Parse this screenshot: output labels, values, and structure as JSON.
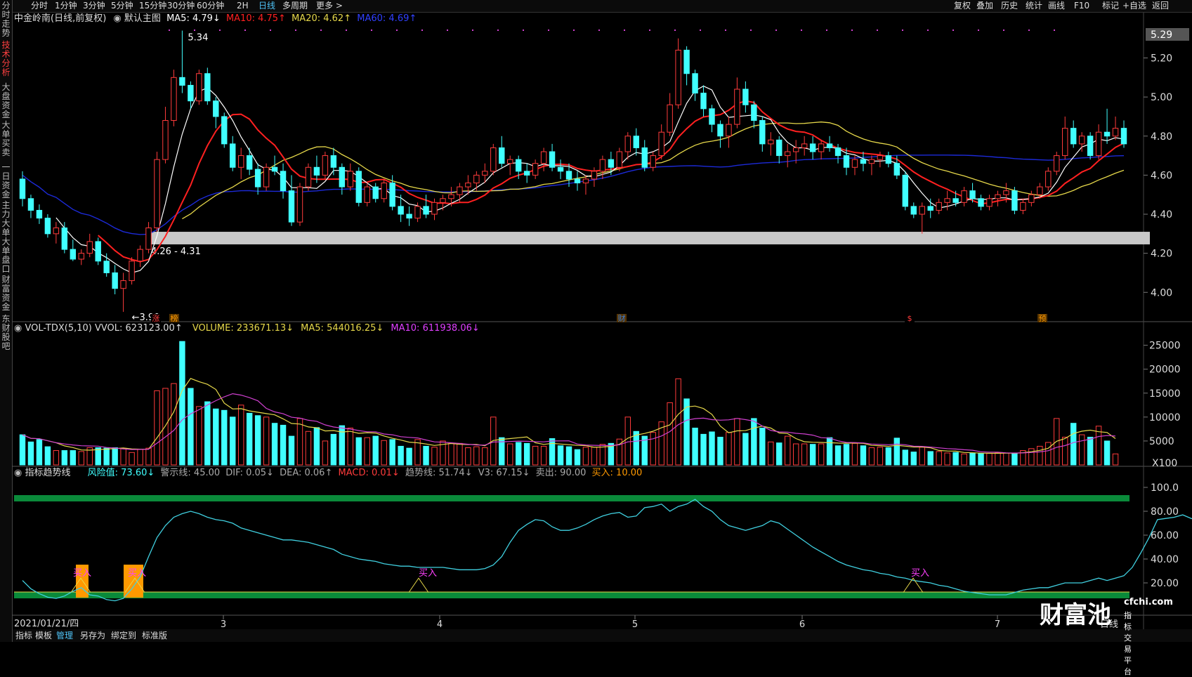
{
  "left_tabs": [
    {
      "label": "分时走势",
      "active": false
    },
    {
      "label": "技术分析",
      "active": true
    },
    {
      "label": "大盘资金",
      "active": false
    },
    {
      "label": "大单买卖",
      "active": false
    },
    {
      "label": "一日资金",
      "active": false
    },
    {
      "label": "主力大单",
      "active": false
    },
    {
      "label": "大单盘口",
      "active": false
    },
    {
      "label": "财富资金",
      "active": false
    },
    {
      "label": "东财股吧",
      "active": false
    }
  ],
  "top_periods": [
    "分时",
    "1分钟",
    "3分钟",
    "5分钟",
    "15分钟",
    "30分钟",
    "60分钟",
    "2H",
    "日线",
    "多周期",
    "更多 >"
  ],
  "active_period": "日线",
  "top_right": [
    "复权",
    "叠加",
    "历史",
    "统计",
    "画线",
    "F10",
    "标记",
    "+自选",
    "返回"
  ],
  "kline_header": {
    "stock": "中金岭南(日线,前复权)",
    "template": "默认主图",
    "ma5": "MA5: 4.79↓",
    "ma10": "MA10: 4.75↑",
    "ma20": "MA20: 4.62↑",
    "ma60": "MA60: 4.69↑"
  },
  "price_axis": {
    "top": "5.29",
    "ticks": [
      "5.20",
      "5.00",
      "4.80",
      "4.60",
      "4.40",
      "4.20",
      "4.00"
    ]
  },
  "annotations": {
    "high": "5.34",
    "low": "3.90",
    "band": "4.26 - 4.31"
  },
  "event_marks": [
    "涨",
    "榜",
    "财",
    "$",
    "预"
  ],
  "vol_header": {
    "name": "VOL-TDX(5,10)",
    "vvol": "VVOL: 623123.00↑",
    "volume": "VOLUME: 233671.13↓",
    "ma5": "MA5: 544016.25↓",
    "ma10": "MA10: 611938.06↓"
  },
  "vol_axis": {
    "ticks": [
      "25000",
      "20000",
      "15000",
      "10000",
      "5000"
    ],
    "unit": "X100"
  },
  "ind_header": {
    "name": "指标趋势线",
    "risk": "风险值: 73.60↓",
    "warn": "警示线: 45.00",
    "dif": "DIF: 0.05↓",
    "dea": "DEA: 0.06↑",
    "macd": "MACD: 0.01↓",
    "trend": "趋势线: 51.74↓",
    "v3": "V3: 67.15↓",
    "sell": "卖出: 90.00",
    "buy": "买入: 10.00"
  },
  "ind_axis": {
    "ticks": [
      "100.0",
      "80.00",
      "60.00",
      "40.00",
      "20.00"
    ]
  },
  "buy_label": "买入",
  "date_axis": {
    "first": "2021/01/21/四",
    "months": [
      "3",
      "4",
      "5",
      "6",
      "7"
    ],
    "right": "日线"
  },
  "bottom_tabs": [
    "指标",
    "模板",
    "管理",
    "另存为",
    "绑定到",
    "标准版"
  ],
  "active_bottom": "管理",
  "watermark": {
    "brand": "财富池",
    "url": "cfchi.com",
    "slogan": "指标交易平台"
  },
  "colors": {
    "up": "#ff3b3b",
    "down": "#40ffff",
    "ma5": "#ffffff",
    "ma10": "#ff2020",
    "ma20": "#e6d84a",
    "ma60": "#1c2ad8",
    "accent": "#4fc3f7",
    "green_band": "#0a8a3a",
    "buy_bar": "#ff9900"
  },
  "chart_data": {
    "type": "candlestick",
    "ylim": [
      3.85,
      5.36
    ],
    "candles": [
      [
        4.58,
        4.62,
        4.44,
        4.48
      ],
      [
        4.48,
        4.5,
        4.38,
        4.42
      ],
      [
        4.42,
        4.45,
        4.35,
        4.38
      ],
      [
        4.38,
        4.4,
        4.28,
        4.3
      ],
      [
        4.3,
        4.36,
        4.25,
        4.33
      ],
      [
        4.33,
        4.36,
        4.2,
        4.22
      ],
      [
        4.22,
        4.27,
        4.16,
        4.17
      ],
      [
        4.17,
        4.22,
        4.14,
        4.2
      ],
      [
        4.2,
        4.3,
        4.18,
        4.26
      ],
      [
        4.26,
        4.28,
        4.14,
        4.16
      ],
      [
        4.16,
        4.2,
        4.08,
        4.1
      ],
      [
        4.1,
        4.14,
        3.99,
        4.02
      ],
      [
        4.02,
        4.1,
        3.9,
        4.06
      ],
      [
        4.06,
        4.18,
        4.04,
        4.16
      ],
      [
        4.16,
        4.24,
        4.13,
        4.22
      ],
      [
        4.22,
        4.36,
        4.2,
        4.33
      ],
      [
        4.33,
        4.72,
        4.31,
        4.68
      ],
      [
        4.68,
        4.95,
        4.66,
        4.88
      ],
      [
        4.88,
        5.14,
        4.85,
        5.1
      ],
      [
        5.1,
        5.34,
        5.02,
        5.06
      ],
      [
        5.06,
        5.08,
        4.94,
        4.98
      ],
      [
        4.98,
        5.14,
        4.96,
        5.12
      ],
      [
        5.12,
        5.15,
        4.96,
        4.98
      ],
      [
        4.98,
        5.0,
        4.84,
        4.9
      ],
      [
        4.9,
        4.92,
        4.74,
        4.76
      ],
      [
        4.76,
        4.8,
        4.62,
        4.64
      ],
      [
        4.64,
        4.74,
        4.58,
        4.7
      ],
      [
        4.7,
        4.74,
        4.6,
        4.63
      ],
      [
        4.63,
        4.66,
        4.5,
        4.54
      ],
      [
        4.54,
        4.66,
        4.52,
        4.64
      ],
      [
        4.64,
        4.7,
        4.6,
        4.62
      ],
      [
        4.62,
        4.66,
        4.48,
        4.52
      ],
      [
        4.52,
        4.6,
        4.34,
        4.36
      ],
      [
        4.36,
        4.56,
        4.34,
        4.54
      ],
      [
        4.54,
        4.66,
        4.52,
        4.64
      ],
      [
        4.64,
        4.7,
        4.56,
        4.6
      ],
      [
        4.6,
        4.72,
        4.58,
        4.7
      ],
      [
        4.7,
        4.74,
        4.6,
        4.64
      ],
      [
        4.64,
        4.66,
        4.5,
        4.54
      ],
      [
        4.54,
        4.66,
        4.52,
        4.62
      ],
      [
        4.62,
        4.64,
        4.44,
        4.46
      ],
      [
        4.46,
        4.56,
        4.44,
        4.54
      ],
      [
        4.54,
        4.56,
        4.46,
        4.48
      ],
      [
        4.48,
        4.58,
        4.46,
        4.56
      ],
      [
        4.56,
        4.6,
        4.42,
        4.44
      ],
      [
        4.44,
        4.5,
        4.36,
        4.4
      ],
      [
        4.4,
        4.44,
        4.34,
        4.38
      ],
      [
        4.38,
        4.46,
        4.36,
        4.44
      ],
      [
        4.44,
        4.5,
        4.38,
        4.4
      ],
      [
        4.4,
        4.48,
        4.37,
        4.46
      ],
      [
        4.46,
        4.5,
        4.42,
        4.48
      ],
      [
        4.48,
        4.54,
        4.44,
        4.5
      ],
      [
        4.5,
        4.56,
        4.46,
        4.54
      ],
      [
        4.54,
        4.6,
        4.5,
        4.56
      ],
      [
        4.56,
        4.62,
        4.52,
        4.6
      ],
      [
        4.6,
        4.66,
        4.56,
        4.62
      ],
      [
        4.62,
        4.76,
        4.6,
        4.74
      ],
      [
        4.74,
        4.8,
        4.64,
        4.66
      ],
      [
        4.66,
        4.7,
        4.6,
        4.68
      ],
      [
        4.68,
        4.7,
        4.58,
        4.62
      ],
      [
        4.62,
        4.66,
        4.56,
        4.6
      ],
      [
        4.6,
        4.68,
        4.58,
        4.66
      ],
      [
        4.66,
        4.74,
        4.62,
        4.72
      ],
      [
        4.72,
        4.76,
        4.62,
        4.64
      ],
      [
        4.64,
        4.68,
        4.58,
        4.62
      ],
      [
        4.62,
        4.66,
        4.54,
        4.58
      ],
      [
        4.58,
        4.62,
        4.52,
        4.56
      ],
      [
        4.56,
        4.6,
        4.5,
        4.58
      ],
      [
        4.58,
        4.64,
        4.54,
        4.62
      ],
      [
        4.62,
        4.7,
        4.58,
        4.68
      ],
      [
        4.68,
        4.72,
        4.6,
        4.64
      ],
      [
        4.64,
        4.74,
        4.62,
        4.72
      ],
      [
        4.72,
        4.82,
        4.68,
        4.8
      ],
      [
        4.8,
        4.84,
        4.7,
        4.74
      ],
      [
        4.74,
        4.78,
        4.62,
        4.64
      ],
      [
        4.64,
        4.72,
        4.62,
        4.7
      ],
      [
        4.7,
        4.86,
        4.68,
        4.82
      ],
      [
        4.82,
        5.02,
        4.8,
        4.96
      ],
      [
        4.96,
        5.3,
        4.94,
        5.24
      ],
      [
        5.24,
        5.26,
        5.06,
        5.12
      ],
      [
        5.12,
        5.14,
        4.98,
        5.02
      ],
      [
        5.02,
        5.06,
        4.9,
        4.94
      ],
      [
        4.94,
        4.96,
        4.82,
        4.86
      ],
      [
        4.86,
        4.88,
        4.74,
        4.8
      ],
      [
        4.8,
        4.9,
        4.74,
        4.86
      ],
      [
        4.86,
        5.1,
        4.84,
        5.04
      ],
      [
        5.04,
        5.08,
        4.92,
        4.96
      ],
      [
        4.96,
        4.98,
        4.84,
        4.88
      ],
      [
        4.88,
        4.9,
        4.72,
        4.76
      ],
      [
        4.76,
        4.82,
        4.7,
        4.78
      ],
      [
        4.78,
        4.8,
        4.66,
        4.7
      ],
      [
        4.7,
        4.76,
        4.64,
        4.72
      ],
      [
        4.72,
        4.78,
        4.66,
        4.74
      ],
      [
        4.74,
        4.8,
        4.7,
        4.76
      ],
      [
        4.76,
        4.8,
        4.68,
        4.72
      ],
      [
        4.72,
        4.78,
        4.68,
        4.76
      ],
      [
        4.76,
        4.8,
        4.72,
        4.74
      ],
      [
        4.74,
        4.76,
        4.66,
        4.7
      ],
      [
        4.7,
        4.74,
        4.6,
        4.64
      ],
      [
        4.64,
        4.7,
        4.6,
        4.68
      ],
      [
        4.68,
        4.72,
        4.62,
        4.66
      ],
      [
        4.66,
        4.7,
        4.6,
        4.68
      ],
      [
        4.68,
        4.72,
        4.64,
        4.7
      ],
      [
        4.7,
        4.72,
        4.64,
        4.66
      ],
      [
        4.66,
        4.7,
        4.58,
        4.6
      ],
      [
        4.6,
        4.62,
        4.42,
        4.44
      ],
      [
        4.44,
        4.46,
        4.38,
        4.4
      ],
      [
        4.4,
        4.46,
        4.3,
        4.44
      ],
      [
        4.44,
        4.48,
        4.38,
        4.42
      ],
      [
        4.42,
        4.48,
        4.4,
        4.46
      ],
      [
        4.46,
        4.52,
        4.42,
        4.48
      ],
      [
        4.48,
        4.52,
        4.44,
        4.46
      ],
      [
        4.46,
        4.54,
        4.44,
        4.52
      ],
      [
        4.52,
        4.56,
        4.46,
        4.48
      ],
      [
        4.48,
        4.5,
        4.42,
        4.44
      ],
      [
        4.44,
        4.5,
        4.42,
        4.48
      ],
      [
        4.48,
        4.52,
        4.44,
        4.5
      ],
      [
        4.5,
        4.56,
        4.46,
        4.52
      ],
      [
        4.52,
        4.54,
        4.4,
        4.42
      ],
      [
        4.42,
        4.48,
        4.4,
        4.46
      ],
      [
        4.46,
        4.52,
        4.44,
        4.5
      ],
      [
        4.5,
        4.56,
        4.48,
        4.54
      ],
      [
        4.54,
        4.64,
        4.52,
        4.62
      ],
      [
        4.62,
        4.72,
        4.6,
        4.7
      ],
      [
        4.7,
        4.9,
        4.68,
        4.84
      ],
      [
        4.84,
        4.88,
        4.74,
        4.76
      ],
      [
        4.76,
        4.82,
        4.72,
        4.8
      ],
      [
        4.8,
        4.82,
        4.68,
        4.7
      ],
      [
        4.7,
        4.86,
        4.68,
        4.82
      ],
      [
        4.82,
        4.94,
        4.76,
        4.8
      ],
      [
        4.8,
        4.9,
        4.78,
        4.84
      ],
      [
        4.84,
        4.88,
        4.74,
        4.76
      ]
    ],
    "vol_ylim": [
      0,
      27000
    ],
    "volumes": [
      6300,
      4800,
      5300,
      3800,
      3000,
      3000,
      3000,
      2800,
      3600,
      3600,
      3500,
      3600,
      3400,
      2600,
      3300,
      3500,
      15500,
      16000,
      17000,
      25800,
      16000,
      12200,
      13200,
      11700,
      11400,
      10000,
      12500,
      10800,
      10300,
      10000,
      8700,
      8300,
      6000,
      9700,
      7000,
      7800,
      5000,
      6400,
      8200,
      7700,
      5700,
      5700,
      6000,
      5100,
      5300,
      3900,
      3500,
      5300,
      3900,
      3700,
      5000,
      4500,
      4500,
      3600,
      3800,
      3600,
      10000,
      5700,
      4400,
      4700,
      4500,
      3900,
      3900,
      5500,
      4000,
      3800,
      3200,
      3700,
      3700,
      4300,
      4500,
      5400,
      10000,
      7000,
      6000,
      6800,
      9000,
      13000,
      18000,
      13800,
      7700,
      6400,
      6900,
      5800,
      6800,
      9700,
      6600,
      9700,
      7700,
      4800,
      4600,
      6000,
      4400,
      4400,
      4300,
      4400,
      5700,
      4000,
      4300,
      4500,
      4000,
      3600,
      3700,
      3600,
      5600,
      3100,
      2700,
      3700,
      2800,
      2800,
      2500,
      2600,
      2300,
      2500,
      2400,
      2400,
      2500,
      2500,
      2400,
      3000,
      3400,
      3900,
      4700,
      9700,
      5800,
      8700,
      6300,
      5800,
      8100,
      5000,
      2300
    ],
    "ind_ylim": [
      0,
      100
    ],
    "risk_line": [
      22,
      15,
      11,
      8,
      7,
      9,
      13,
      16,
      10,
      9,
      6,
      5,
      7,
      15,
      25,
      42,
      58,
      68,
      75,
      78,
      80,
      78,
      75,
      73,
      72,
      70,
      66,
      64,
      62,
      60,
      58,
      56,
      56,
      55,
      54,
      52,
      50,
      48,
      44,
      42,
      40,
      39,
      38,
      36,
      35,
      34,
      34,
      33,
      33,
      33,
      33,
      32,
      31,
      31,
      31,
      32,
      35,
      42,
      54,
      64,
      69,
      73,
      72,
      67,
      64,
      64,
      66,
      69,
      73,
      76,
      78,
      79,
      75,
      76,
      83,
      84,
      86,
      80,
      84,
      86,
      90,
      84,
      80,
      73,
      68,
      66,
      64,
      66,
      68,
      72,
      70,
      65,
      60,
      55,
      50,
      46,
      42,
      38,
      35,
      33,
      31,
      30,
      28,
      27,
      25,
      24,
      22,
      21,
      20,
      18,
      17,
      15,
      13,
      12,
      11,
      10,
      10,
      10,
      12,
      14,
      15,
      16,
      16,
      18,
      20,
      20,
      20,
      22,
      24,
      22,
      24,
      26,
      33,
      45,
      58,
      73,
      74,
      75,
      77,
      74,
      72,
      70,
      78,
      80,
      79,
      77,
      73
    ]
  }
}
